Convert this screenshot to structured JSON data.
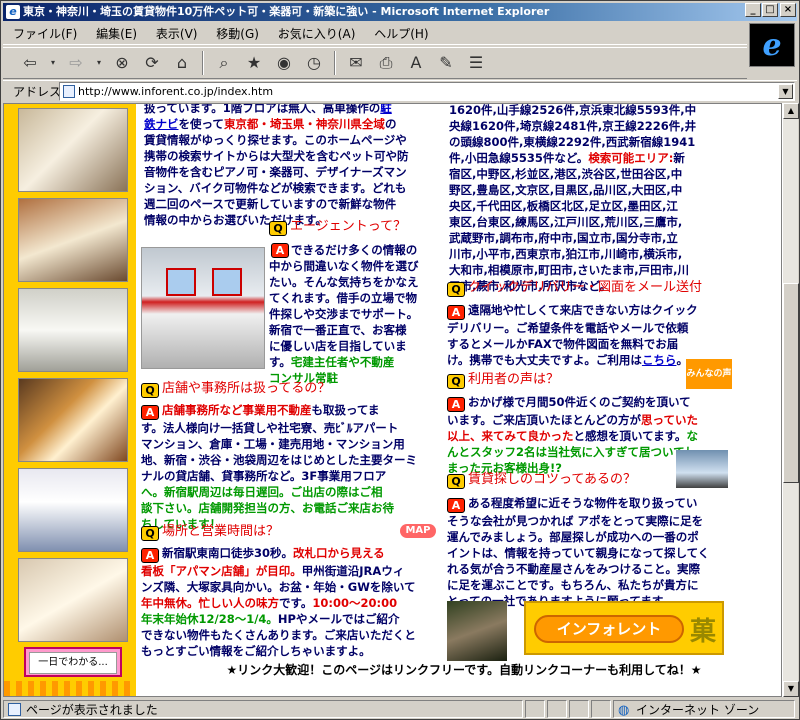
{
  "window": {
    "title": "東京・神奈川・埼玉の賃貸物件10万件ペット可・楽器可・新築に強い - Microsoft Internet Explorer"
  },
  "menu": [
    "ファイル(F)",
    "編集(E)",
    "表示(V)",
    "移動(G)",
    "お気に入り(A)",
    "ヘルプ(H)"
  ],
  "address": {
    "label": "アドレス",
    "url": "http://www.inforent.co.jp/index.htm"
  },
  "left": {
    "button_label": "一日でわかる..."
  },
  "intro": {
    "l1a": "扱っています。1階フロアは無人、高単操作の",
    "l1b": "駐",
    "l2a": "鉄ナビ",
    "l2b": "を使って",
    "l2c": "東京都・埼玉県・神奈川県全域",
    "l2d": "の",
    "l3": "賃貸情報がゆっくり探せます。このホームページや",
    "l4": "携帯の検索サイトからは大型犬を含むペット可や防",
    "l5": "音物件を含むピアノ可・楽器可、デザイナーズマン",
    "l6": "ション、バイク可物件などが検索できます。どれも",
    "l7": "週二回のペースで更新していますので新鮮な物件",
    "l8": "情報の中からお選びいただけます。"
  },
  "qa_agent": {
    "q": "エージェントって？",
    "l1": "できるだけ多くの情報の",
    "l2": "中から間違いなく物件を選び",
    "l3": "たい。そんな気持ちをかなえ",
    "l4": "てくれます。借手の立場で物",
    "l5": "件探しや交渉までサポート。",
    "l6": "新宿で一番正直で、お客様",
    "l7": "に優しい店を目指していま",
    "l8a": "す。",
    "l8b": "宅建主任者や不動産",
    "l9": "コンサル常駐"
  },
  "qa_store": {
    "q": "店舗や事務所は扱ってるの？",
    "l1a": "店舗事務所など事業用不動産",
    "l1b": "も取扱ってま",
    "l2": "す。法人様向け一括貸しや社宅寮、売ﾋﾞﾙアパート",
    "l3": "マンション、倉庫・工場・建売用地・マンション用",
    "l4": "地、新宿・渋谷・池袋周辺をはじめとした主要ターミ",
    "l5": "ナルの貸店舗、貸事務所など。3F事業用フロア",
    "l6": "へ。新宿駅周辺は毎日遅回。ご出店の際はご相",
    "l7": "談下さい。店舗開発担当の方、お電話ご来店お待",
    "l8": "ちしています！"
  },
  "qa_hours": {
    "q": "場所と営業時間は？",
    "map": "MAP",
    "l1a": "新宿駅東南口徒歩30秒。",
    "l1b": "改札口から見える",
    "l2a": "看板「アパマン店舗」が目印。",
    "l2b": "甲州街道沿JRAウィ",
    "l3": "ンズ隣、大塚家具向かい。お盆・年始・GWを除いて",
    "l4a": "年中無休。",
    "l4b": "忙しい人の味方",
    "l4c": "です。",
    "l4d": "10:00～20:00",
    "l5a": "年末年始休12/28～1/4。",
    "l5b": "HPやメールではご紹介",
    "l6": "できない物件もたくさんあります。ご来店いただくと",
    "l7": "もっとすごい情報をご紹介しちゃいますよ。"
  },
  "right_top": {
    "l1": "1620件,山手線2526件,京浜東北線5593件,中",
    "l2": "央線1620件,埼京線2481件,京王線2226件,井",
    "l3": "の頭線800件,東横線2292件,西武新宿線1941",
    "l4a": "件,小田急線5535件など。",
    "l4b": "検索可能エリア:",
    "l4c": "新",
    "l5": "宿区,中野区,杉並区,港区,渋谷区,世田谷区,中",
    "l6": "野区,豊島区,文京区,目黒区,品川区,大田区,中",
    "l7": "央区,千代田区,板橋区北区,足立区,墨田区,江",
    "l8": "東区,台東区,練馬区,江戸川区,荒川区,三鷹市,",
    "l9": "武蔵野市,調布市,府中市,国立市,国分寺市,立",
    "l10": "川市,小平市,西東京市,狛江市,川崎市,横浜市,",
    "l11": "大和市,相模原市,町田市,さいたま市,戸田市,川",
    "l12": "口市,蕨市,和光市,所沢市など。"
  },
  "qa_delivery": {
    "q": "クイックデリバリー・図面をメール送付",
    "l1": "遠隔地や忙しくて来店できない方はクイック",
    "l2": "デリバリー。ご希望条件を電話やメールで依頼",
    "l3": "するとメールかFAXで物件図面を無料でお届",
    "l4a": "け。携帯でも大丈夫ですよ。ご利用は",
    "l4b": "こちら",
    "l4c": "。"
  },
  "qa_voice": {
    "q": "利用者の声は？",
    "icon_text": "みんなの声",
    "l1": "おかげ様で月間50件近くのご契約を頂いて",
    "l2a": "います。ご来店頂いたほとんどの方が",
    "l2b": "思っていた",
    "l3a": "以上、来てみて良かった",
    "l3b": "と感想を頂いてます。",
    "l3c": "な",
    "l4": "んとスタッフ2名は当社気に入すぎて居ついてし",
    "l5": "まった元お客様出身!?"
  },
  "qa_tips": {
    "q": "賃貸探しのコツってあるの？",
    "l1": "ある程度希望に近そうな物件を取り扱ってい",
    "l2": "そうな会社が見つかれば アポをとって実際に足を",
    "l3": "運んでみましょう。部屋探しが成功への一番のポ",
    "l4": "イントは、情報を持っていて親身になって探してく",
    "l5": "れる気が合う不動産屋さんをみつけること。実際",
    "l6": "に足を運ぶことです。もちろん、私たちが貴方に",
    "l7": "とっての一社でありますように願ってます。"
  },
  "logo": {
    "text": "インフォレント",
    "kanji": "菓"
  },
  "footer": "★リンク大歓迎！このページはリンクフリーです。自動リンクコーナーも利用してね！★",
  "status": {
    "text": "ページが表示されました",
    "zone": "インターネット ゾーン"
  }
}
